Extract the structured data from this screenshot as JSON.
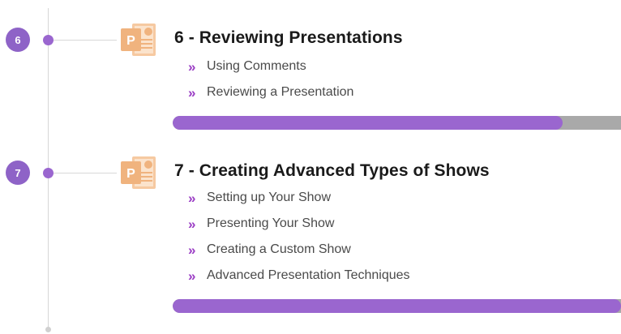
{
  "modules": [
    {
      "number": "6",
      "title": "6 - Reviewing Presentations",
      "lessons": [
        "Using Comments",
        "Reviewing a Presentation"
      ],
      "progress": 0.87,
      "icon": "powerpoint-icon"
    },
    {
      "number": "7",
      "title": "7 - Creating Advanced Types of Shows",
      "lessons": [
        "Setting up Your Show",
        "Presenting Your Show",
        "Creating a Custom Show",
        "Advanced Presentation Techniques"
      ],
      "progress": 1.0,
      "icon": "powerpoint-icon"
    }
  ],
  "bullet_glyph": "»",
  "colors": {
    "accent": "#9a66cf",
    "badge": "#8e63c7",
    "bullet": "#9a3cc4",
    "track": "#a9a9a9",
    "icon": "#f0b37e"
  }
}
